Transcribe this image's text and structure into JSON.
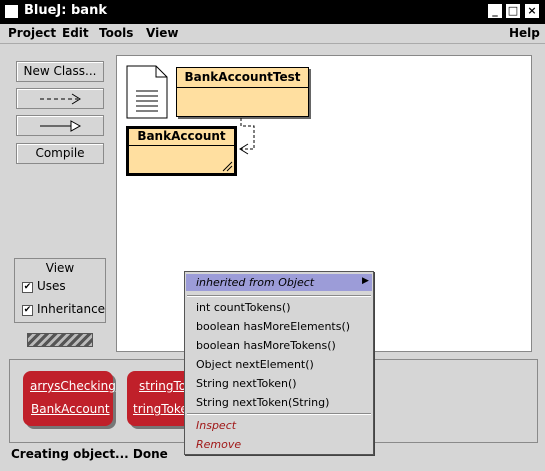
{
  "window": {
    "title": "BlueJ:  bank"
  },
  "menubar": {
    "items": [
      "Project",
      "Edit",
      "Tools",
      "View"
    ],
    "help": "Help"
  },
  "toolbar": {
    "new_class": "New Class...",
    "compile": "Compile"
  },
  "classes": [
    {
      "name": "BankAccountTest"
    },
    {
      "name": "BankAccount"
    }
  ],
  "view_panel": {
    "title": "View",
    "options": [
      {
        "label": "Uses",
        "checked": true
      },
      {
        "label": "Inheritance",
        "checked": true
      }
    ]
  },
  "object_bench": {
    "objects": [
      {
        "line1": "arrysChecking",
        "line2": "BankAccount"
      },
      {
        "line1": "stringTo",
        "line2": "tringToke"
      }
    ]
  },
  "context_menu": {
    "header": "inherited from Object",
    "methods": [
      "int countTokens()",
      "boolean hasMoreElements()",
      "boolean hasMoreTokens()",
      "Object nextElement()",
      "String nextToken()",
      "String nextToken(String)"
    ],
    "actions": [
      "Inspect",
      "Remove"
    ]
  },
  "status": "Creating object... Done",
  "colors": {
    "class_fill": "#ffdfa0",
    "object_fill": "#c0202a",
    "menu_highlight": "#9c9cd8"
  }
}
